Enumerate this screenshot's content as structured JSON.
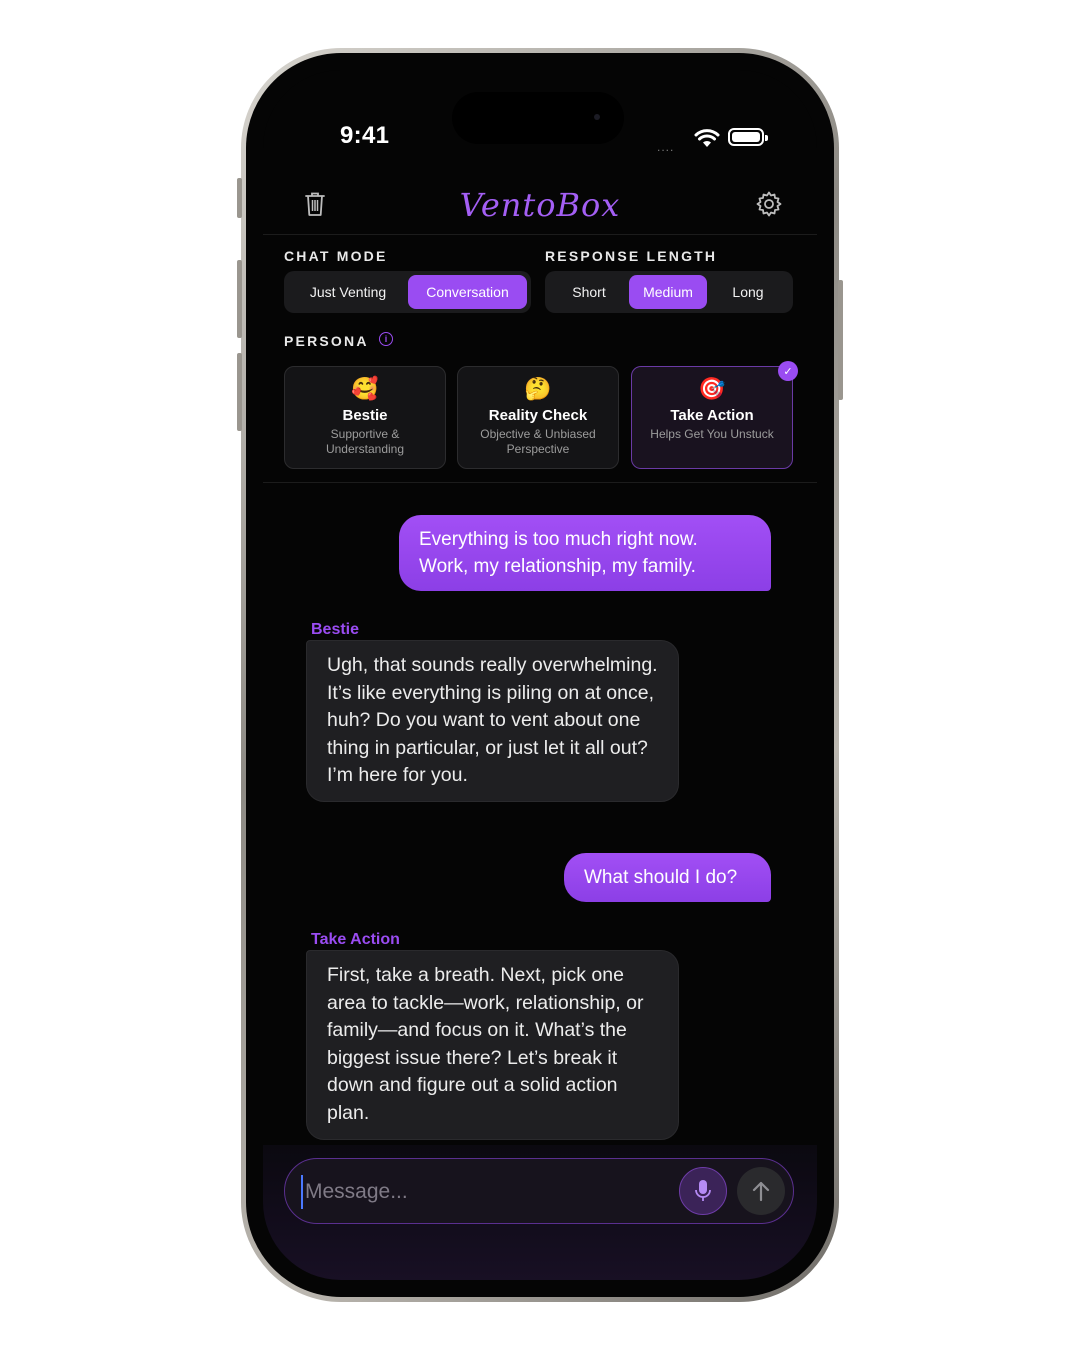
{
  "status_bar": {
    "time": "9:41",
    "signal_dots": "...."
  },
  "header": {
    "title": "VentoBox",
    "left_icon": "trash-icon",
    "right_icon": "gear-icon"
  },
  "chat_mode": {
    "label": "CHAT MODE",
    "options": [
      "Just Venting",
      "Conversation"
    ],
    "selected": "Conversation"
  },
  "response_length": {
    "label": "RESPONSE LENGTH",
    "options": [
      "Short",
      "Medium",
      "Long"
    ],
    "selected": "Medium"
  },
  "persona": {
    "label": "PERSONA",
    "info_icon": "info-icon",
    "items": [
      {
        "emoji": "🥰",
        "name": "Bestie",
        "desc": "Supportive & Understanding"
      },
      {
        "emoji": "🤔",
        "name": "Reality Check",
        "desc": "Objective & Unbiased Perspective"
      },
      {
        "emoji": "🎯",
        "name": "Take Action",
        "desc": "Helps Get You Unstuck"
      }
    ],
    "selected": "Take Action"
  },
  "messages": [
    {
      "role": "user",
      "text": "Everything is too much right now. Work, my relationship, my family."
    },
    {
      "role": "bot",
      "sender": "Bestie",
      "text": "Ugh, that sounds really overwhelming. It’s like everything is piling on at once, huh? Do you want to vent about one thing in particular, or just let it all out? I’m here for you."
    },
    {
      "role": "user",
      "text": "What should I do?"
    },
    {
      "role": "bot",
      "sender": "Take Action",
      "text": "First, take a breath. Next, pick one area to tackle—work, relationship, or family—and focus on it. What’s the biggest issue there? Let’s break it down and figure out a solid action plan."
    }
  ],
  "composer": {
    "placeholder": "Message...",
    "mic_icon": "microphone-icon",
    "send_icon": "arrow-up-icon"
  },
  "colors": {
    "accent": "#9a4cf2",
    "background": "#050505",
    "bubble_bot": "#1f1f22"
  }
}
